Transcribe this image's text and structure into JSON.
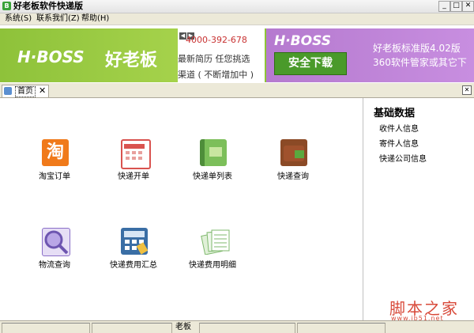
{
  "window": {
    "title": "好老板软件快递版",
    "app_icon": "B"
  },
  "titlebar_buttons": {
    "minimize": "_",
    "maximize": "□",
    "close": "✕"
  },
  "menu": [
    "系统(S)",
    "联系我们(Z)",
    "帮助(H)"
  ],
  "banner": {
    "logo": "H·BOSS",
    "brand": "好老板",
    "phone": "4000-392-678",
    "mid_line1": "最新简历 任您挑选",
    "mid_line2": "渠道 ( 不断增加中 )",
    "right_logo": "H·BOSS",
    "download": "安全下载",
    "promo_line1": "好老板标准版4.02版",
    "promo_line2": "360软件管家或其它下",
    "colors": {
      "green": "#8fc436",
      "purple": "#c88ee0"
    }
  },
  "tab": {
    "label": "首页",
    "close": "✕"
  },
  "tiles": [
    {
      "label": "淘宝订单",
      "icon": "taobao-icon",
      "glyph": "淘",
      "color": "#f07a1a"
    },
    {
      "label": "快递开单",
      "icon": "calendar-icon",
      "color": "#d9534f"
    },
    {
      "label": "快递单列表",
      "icon": "book-icon",
      "color": "#6aa84f"
    },
    {
      "label": "快递查询",
      "icon": "wallet-icon",
      "color": "#a0522d"
    },
    {
      "label": "物流查询",
      "icon": "magnifier-icon",
      "color": "#8a6fc8"
    },
    {
      "label": "快递费用汇总",
      "icon": "calculator-icon",
      "color": "#4a7fc1"
    },
    {
      "label": "快递费用明细",
      "icon": "documents-icon",
      "color": "#7fb96e"
    }
  ],
  "side": {
    "title": "基础数据",
    "items": [
      "收件人信息",
      "寄件人信息",
      "快递公司信息"
    ]
  },
  "status": {
    "text": "老板"
  },
  "watermark": {
    "cn": "脚本之家",
    "url": "www.jb51.net"
  }
}
